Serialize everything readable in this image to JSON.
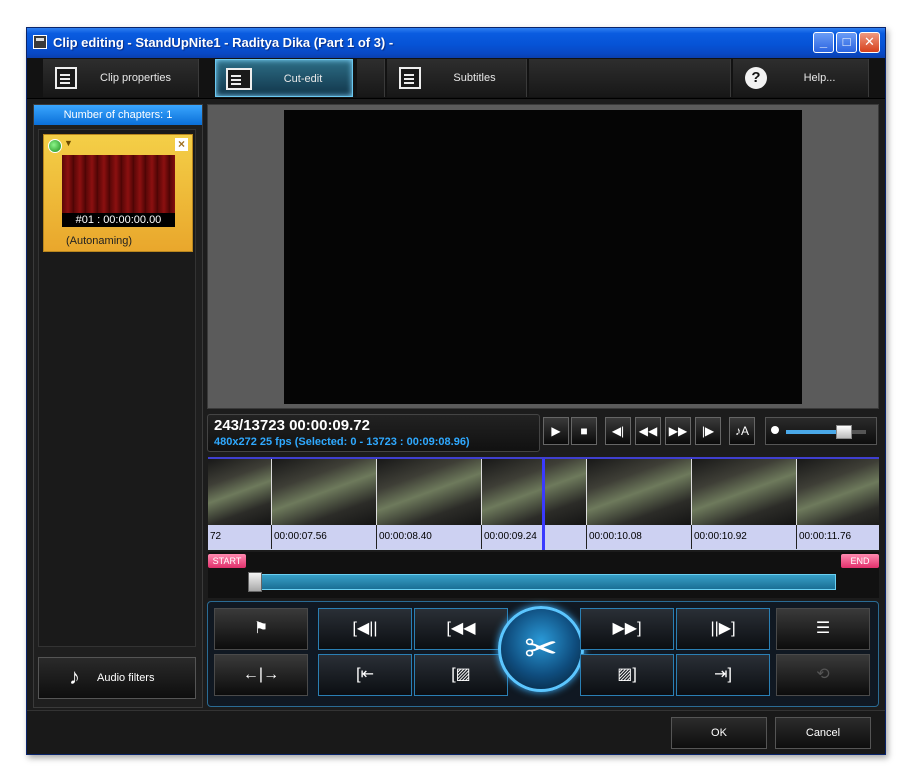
{
  "window": {
    "title": "Clip editing - StandUpNite1 - Raditya Dika (Part 1 of 3) -",
    "minimize_glyph": "_",
    "maximize_glyph": "□",
    "close_glyph": "✕"
  },
  "toolbar": {
    "tabs": [
      {
        "label": "Clip properties",
        "icon": "document-list-icon"
      },
      {
        "label": "Cut-edit",
        "icon": "film-cut-icon",
        "active": true
      },
      {
        "label": "Subtitles",
        "icon": "subtitle-edit-icon"
      },
      {
        "label": "Help...",
        "icon": "help-icon",
        "glyph": "?"
      }
    ]
  },
  "chapters": {
    "header": "Number of chapters: 1",
    "items": [
      {
        "timecode": "#01 : 00:00:00.00",
        "name": "(Autonaming)"
      }
    ]
  },
  "audio_filters": {
    "label": "Audio filters",
    "glyph": "♪"
  },
  "info": {
    "frame_time": "243/13723  00:00:09.72",
    "details": "480x272 25  fps  (Selected: 0 - 13723 : 00:09:08.96)"
  },
  "transport": {
    "play": "▶",
    "stop": "■",
    "prev_frame": "◀|",
    "rewind": "◀◀",
    "fast_forward": "▶▶",
    "next_frame": "|▶",
    "audio_track": "♪A"
  },
  "volume": {
    "level": 0.72
  },
  "timeline": {
    "labels": [
      "72",
      "00:00:07.56",
      "00:00:08.40",
      "00:00:09.24",
      "00:00:10.08",
      "00:00:10.92",
      "00:00:11.76"
    ]
  },
  "range": {
    "start_label": "START",
    "end_label": "END"
  },
  "edit_controls": {
    "marker": "⚑",
    "split": "←|→",
    "set_start": "[◀||",
    "to_start": "[◀◀",
    "to_end": "▶▶]",
    "set_end": "||▶]",
    "cut_start": "[⇤",
    "delete_start": "[▨",
    "delete_end": "▨]",
    "cut_end": "⇥]",
    "list": "☰",
    "undo": "⟲",
    "scissors": "✂"
  },
  "footer": {
    "ok": "OK",
    "cancel": "Cancel"
  },
  "colors": {
    "accent": "#2fa9ff",
    "title_bar": "#0653d6",
    "chapter_card": "#f4cf47",
    "range": "#37a0c8",
    "start_end_flag": "#e0306c"
  }
}
